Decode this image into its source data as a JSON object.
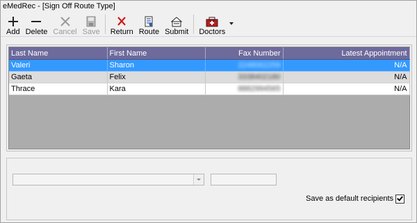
{
  "window": {
    "title": "eMedRec - [Sign Off Route Type]"
  },
  "toolbar": {
    "buttons": [
      {
        "label": "Add",
        "icon": "plus-icon",
        "enabled": true
      },
      {
        "label": "Delete",
        "icon": "minus-icon",
        "enabled": true
      },
      {
        "label": "Cancel",
        "icon": "x-icon",
        "enabled": false
      },
      {
        "label": "Save",
        "icon": "floppy-disk-icon",
        "enabled": false
      },
      {
        "label": "Return",
        "icon": "red-x-icon",
        "enabled": true
      },
      {
        "label": "Route",
        "icon": "route-document-icon",
        "enabled": true
      },
      {
        "label": "Submit",
        "icon": "submit-icon",
        "enabled": true
      },
      {
        "label": "Doctors",
        "icon": "doctors-icon",
        "enabled": true
      }
    ]
  },
  "grid": {
    "columns": [
      "Last Name",
      "First Name",
      "Fax Number",
      "Latest Appointment"
    ],
    "rows": [
      {
        "last": "Valeri",
        "first": "Sharon",
        "fax": "2248062259",
        "appt": "N/A",
        "selected": true
      },
      {
        "last": "Gaeta",
        "first": "Felix",
        "fax": "3338402180",
        "appt": "N/A",
        "selected": false
      },
      {
        "last": "Thrace",
        "first": "Kara",
        "fax": "8882994565",
        "appt": "N/A",
        "selected": false
      }
    ]
  },
  "bottom": {
    "combo_value": "",
    "textbox_value": "",
    "default_label": "Save as default recipients",
    "default_checked": true
  },
  "colors": {
    "header_bg": "#6d6a9c",
    "selected_row": "#3399ff",
    "alt_row": "#dcdcdc",
    "grid_empty": "#acacac"
  }
}
